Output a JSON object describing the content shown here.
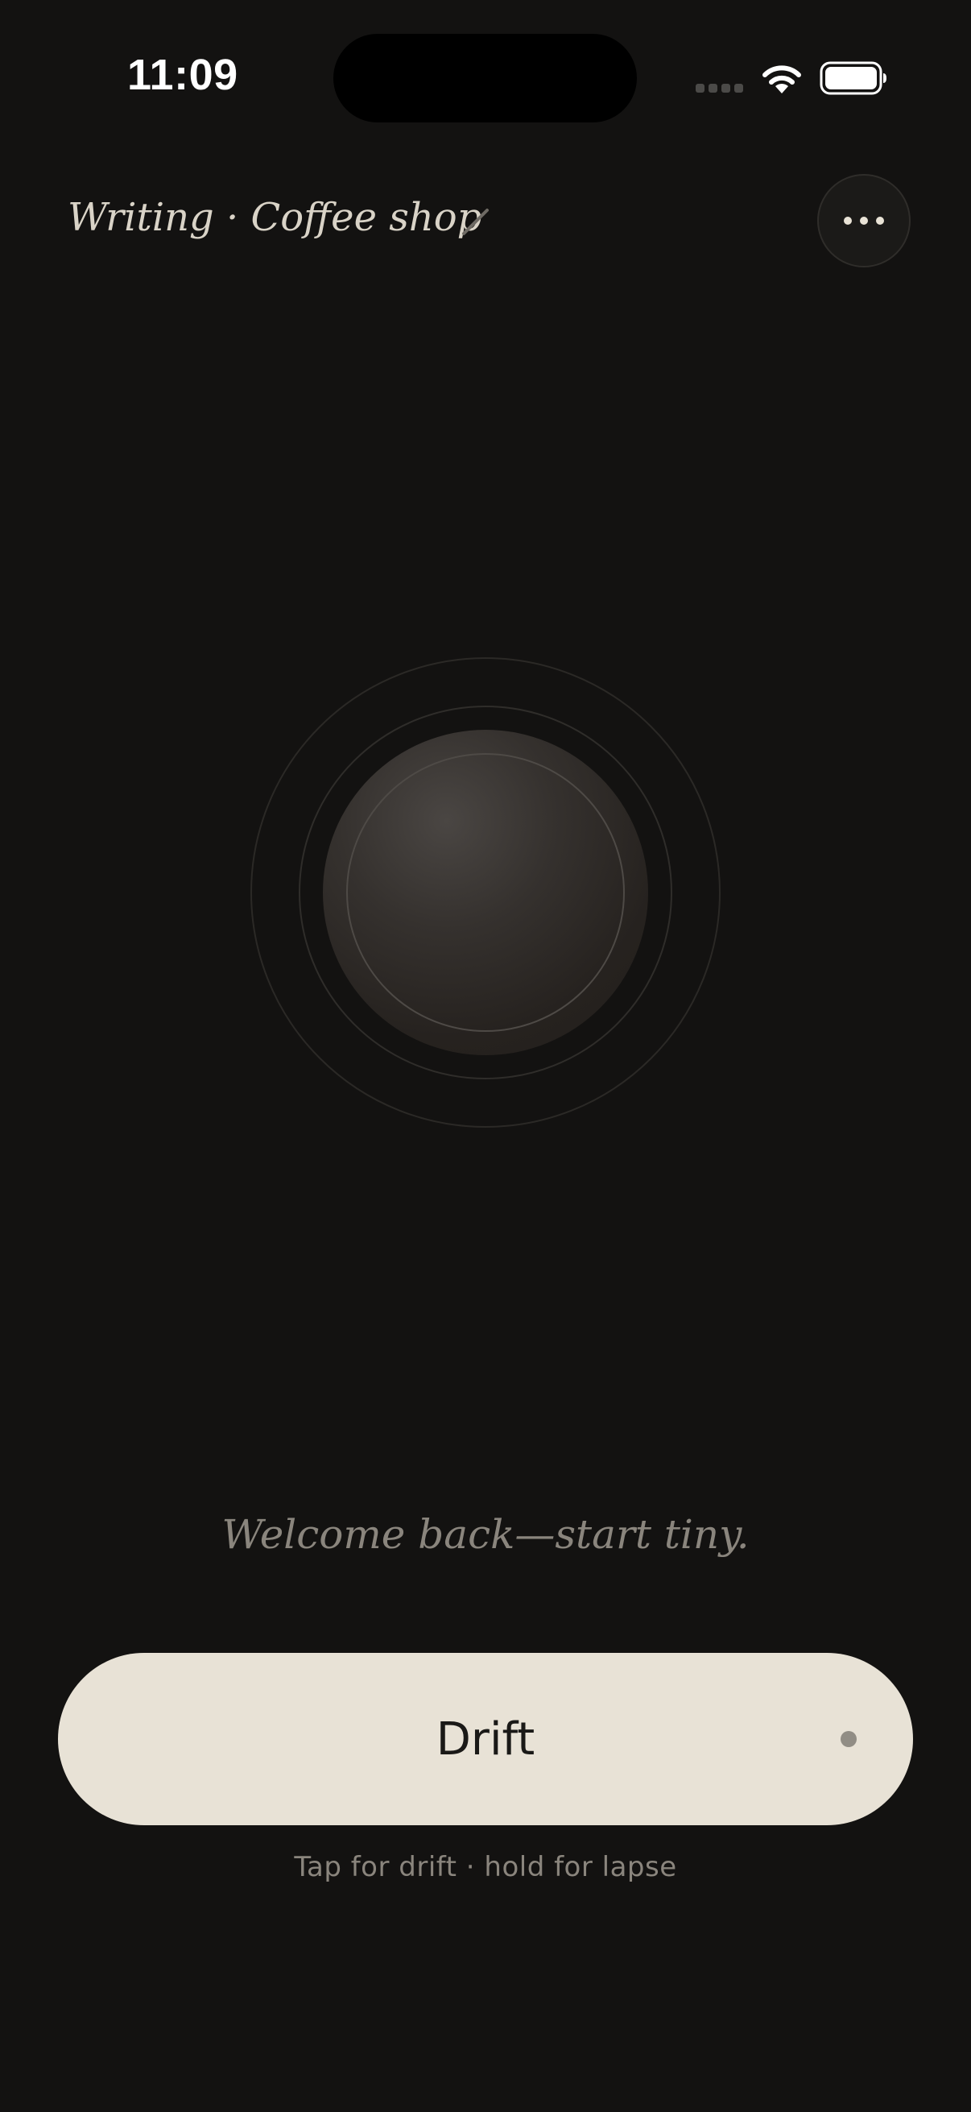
{
  "status_bar": {
    "time": "11:09",
    "wifi_icon": "wifi-icon",
    "battery_icon": "battery-icon"
  },
  "header": {
    "title": "Writing · Coffee shop",
    "edit_icon": "pencil-icon",
    "more_icon": "ellipsis-icon"
  },
  "main": {
    "message": "Welcome back—start tiny."
  },
  "action": {
    "button_label": "Drift",
    "hint": "Tap for drift · hold for lapse"
  },
  "colors": {
    "background": "#131211",
    "button": "#e8e2d6",
    "muted_text": "#8a857d"
  }
}
